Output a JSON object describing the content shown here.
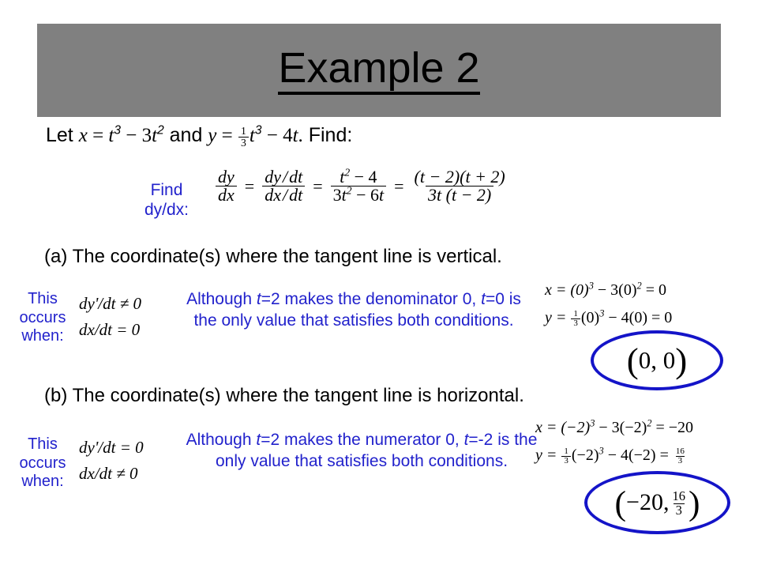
{
  "slide": {
    "title": "Example 2",
    "banner_color": "#808080",
    "accent_blue": "#2222CC",
    "circle_blue": "#1414C8"
  },
  "given": {
    "prefix": "Let ",
    "x_var": "x",
    "x_eq": " = ",
    "x_expr_t1": "t",
    "x_expr_exp1": "3",
    "x_expr_minus": " − 3",
    "x_expr_t2": "t",
    "x_expr_exp2": "2",
    "conj": " and ",
    "y_var": "y",
    "y_eq": " = ",
    "y_frac_num": "1",
    "y_frac_den": "3",
    "y_expr_t1": "t",
    "y_expr_exp1": "3",
    "y_expr_minus": " − 4",
    "y_expr_t2": "t",
    "period": ".",
    "find": " Find:"
  },
  "derivative": {
    "label_line1": "Find",
    "label_line2": "dy/dx:",
    "f1_num": "dy",
    "f1_den": "dx",
    "eq1": "=",
    "f2_num_a": "dy",
    "f2_num_slash": "/",
    "f2_num_b": "dt",
    "f2_den_a": "dx",
    "f2_den_slash": "/",
    "f2_den_b": "dt",
    "eq2": "=",
    "f3_num_t": "t",
    "f3_num_exp": "2",
    "f3_num_rest": " − 4",
    "f3_den_a": "3",
    "f3_den_t": "t",
    "f3_den_exp": "2",
    "f3_den_rest": " − 6",
    "f3_den_t2": "t",
    "eq3": "=",
    "f4_num": "(t − 2)(t + 2)",
    "f4_den": "3t (t − 2)"
  },
  "part_a": {
    "prompt": "(a) The coordinate(s) where the tangent line is vertical.",
    "occurs_line1": "This",
    "occurs_line2": "occurs",
    "occurs_line3": "when:",
    "cond1_frac_num": "dy'",
    "cond1_frac_den": "dx",
    "cond1_text": "dy'/dt ≠ 0",
    "cond2_text": "dx/dt = 0",
    "explanation": "Although t=2 makes the denominator 0, t=0 is the only value that satisfies both conditions.",
    "explain_part1": "Although ",
    "explain_t1": "t",
    "explain_part2": "=2 makes the denominator 0, ",
    "explain_t2": "t",
    "explain_part3": "=0 is the only value that satisfies both conditions.",
    "subst_x": "x = (0)",
    "subst_x_exp": "3",
    "subst_x_mid": " − 3(0)",
    "subst_x_exp2": "2",
    "subst_x_end": " = 0",
    "subst_y_lead": "y = ",
    "subst_y_fnum": "1",
    "subst_y_fden": "3",
    "subst_y_mid": "(0)",
    "subst_y_exp": "3",
    "subst_y_mid2": " − 4(0) = 0",
    "answer": "0, 0"
  },
  "part_b": {
    "prompt": "(b) The coordinate(s) where the tangent line is horizontal.",
    "occurs_line1": "This",
    "occurs_line2": "occurs",
    "occurs_line3": "when:",
    "cond1_text": "dy'/dt = 0",
    "cond2_text": "dx/dt ≠ 0",
    "explanation": "Although t=2 makes the numerator 0, t=-2 is the only value that satisfies both conditions.",
    "explain_part1": "Although ",
    "explain_t1": "t",
    "explain_part2": "=2 makes the numerator 0, ",
    "explain_t2": "t",
    "explain_part3": "=-2 is the only value that satisfies both conditions.",
    "subst_x": "x = (−2)",
    "subst_x_exp": "3",
    "subst_x_mid": " − 3(−2)",
    "subst_x_exp2": "2",
    "subst_x_end": " = −20",
    "subst_y_lead": "y = ",
    "subst_y_fnum": "1",
    "subst_y_fden": "3",
    "subst_y_mid": "(−2)",
    "subst_y_exp": "3",
    "subst_y_mid2": " − 4(−2) = ",
    "subst_y_rnum": "16",
    "subst_y_rden": "3",
    "answer_lead": "−20, ",
    "answer_fnum": "16",
    "answer_fden": "3"
  }
}
